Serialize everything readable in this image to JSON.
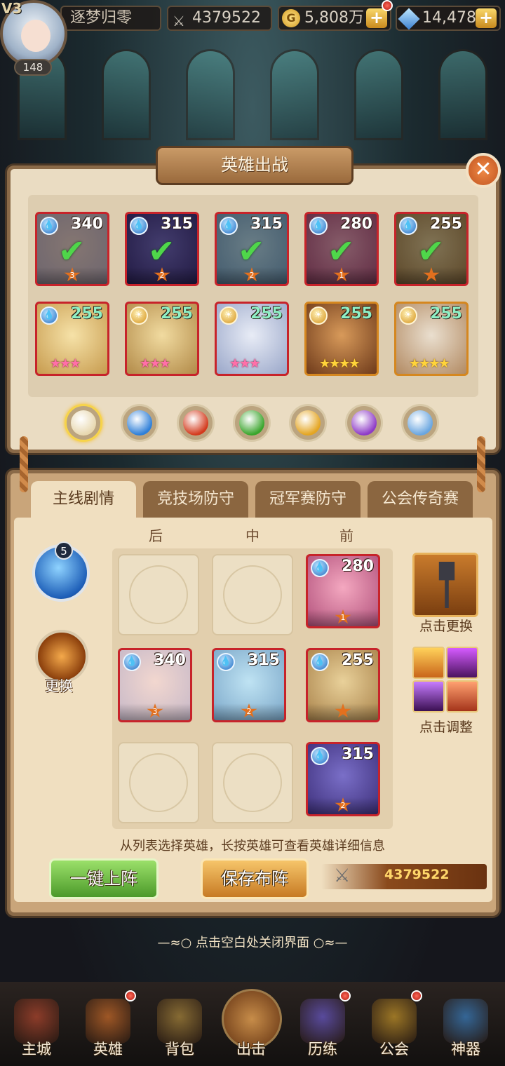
{
  "player": {
    "vip": "V3",
    "level": "148",
    "name": "逐梦归零",
    "power": "4379522",
    "gold": "5,808万",
    "gems": "14,478",
    "gold_icon_text": "G"
  },
  "dialog": {
    "title": "英雄出战",
    "close_symbol": "✕"
  },
  "roster": [
    {
      "element": "water",
      "level": "340",
      "rank": "3",
      "deployed": true,
      "frame": "red"
    },
    {
      "element": "water",
      "level": "315",
      "rank": "2",
      "deployed": true,
      "frame": "red"
    },
    {
      "element": "water",
      "level": "315",
      "rank": "2",
      "deployed": true,
      "frame": "red"
    },
    {
      "element": "water",
      "level": "280",
      "rank": "1",
      "deployed": true,
      "frame": "red"
    },
    {
      "element": "water",
      "level": "255",
      "rank": "",
      "deployed": true,
      "frame": "red"
    },
    {
      "element": "water",
      "level": "255",
      "stars": "★★★",
      "frame": "red"
    },
    {
      "element": "light",
      "level": "255",
      "stars": "★★★",
      "frame": "red"
    },
    {
      "element": "light",
      "level": "255",
      "stars": "★★★",
      "frame": "red"
    },
    {
      "element": "light",
      "level": "255",
      "stars": "★★★★",
      "frame": "gold"
    },
    {
      "element": "light",
      "level": "255",
      "stars": "★★★★",
      "frame": "gold"
    }
  ],
  "filters": [
    {
      "name": "all",
      "color": "#e8d8b0"
    },
    {
      "name": "water",
      "color": "#2e7fd8"
    },
    {
      "name": "fire",
      "color": "#d33a1d"
    },
    {
      "name": "wind",
      "color": "#3aa52c"
    },
    {
      "name": "light",
      "color": "#e4a521"
    },
    {
      "name": "dark",
      "color": "#8e3bc7"
    },
    {
      "name": "neutral",
      "color": "#6aa6e0"
    }
  ],
  "tabs": [
    "主线剧情",
    "竞技场防守",
    "冠军赛防守",
    "公会传奇赛"
  ],
  "columns": [
    "后",
    "中",
    "前"
  ],
  "formation": {
    "front_top": {
      "level": "280",
      "rank": "1"
    },
    "back_mid": {
      "level": "340",
      "rank": "3"
    },
    "mid_mid": {
      "level": "315",
      "rank": "2"
    },
    "front_mid": {
      "level": "255",
      "rank": ""
    },
    "front_bot": {
      "level": "315",
      "rank": "2"
    }
  },
  "element_count": "5",
  "swap_label": "更换",
  "weapon_label": "点击更换",
  "skill_label": "点击调整",
  "hint": "从列表选择英雄，长按英雄可查看英雄详细信息",
  "buttons": {
    "auto": "一键上阵",
    "save": "保存布阵"
  },
  "team_power": "4379522",
  "close_hint": "—≈○ 点击空白处关闭界面 ○≈—",
  "nav": [
    "主城",
    "英雄",
    "背包",
    "出击",
    "历练",
    "公会",
    "神器"
  ],
  "colors": {
    "frame_red": "#c7232a",
    "frame_gold": "#d5871f",
    "accent": "#8a6a48"
  }
}
